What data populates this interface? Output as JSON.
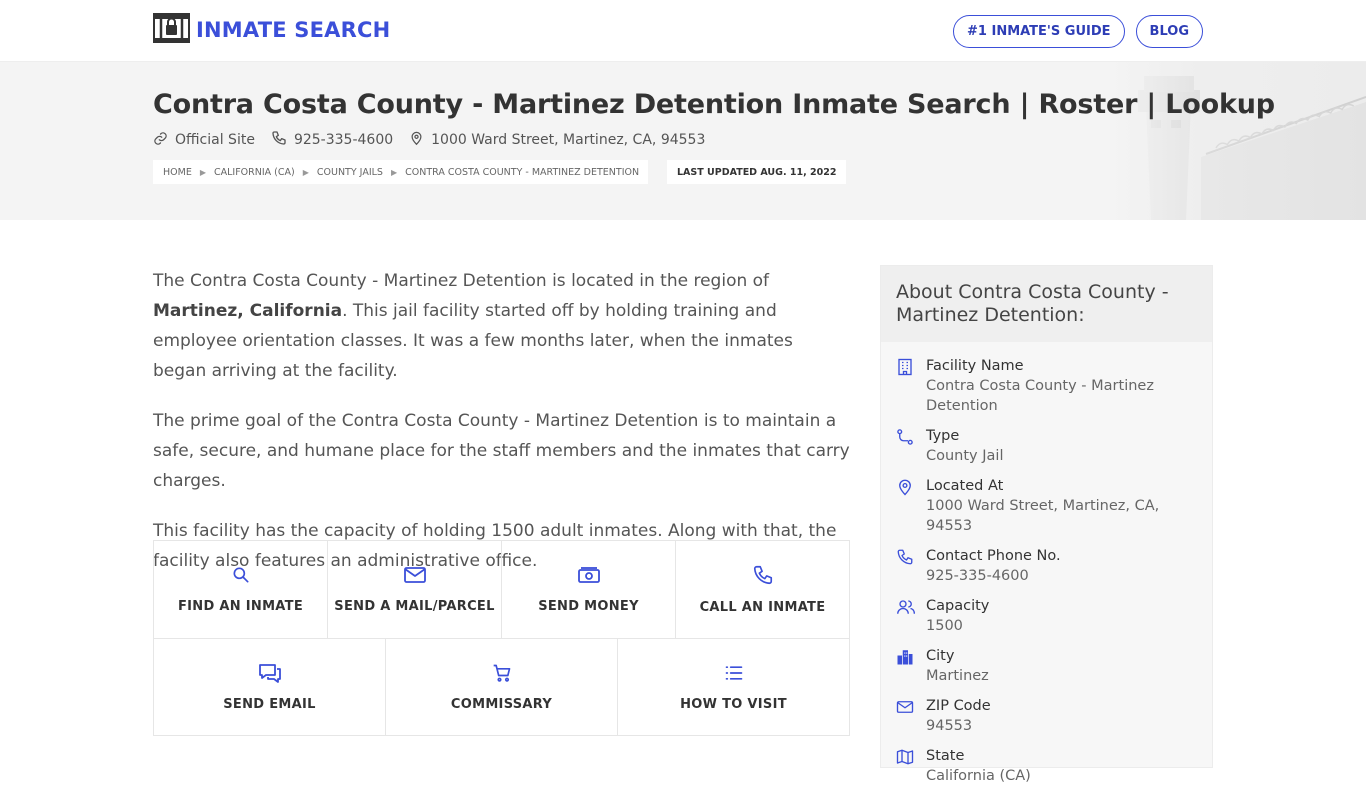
{
  "header": {
    "brand": "INMATE SEARCH",
    "nav": [
      "#1 INMATE'S GUIDE",
      "BLOG"
    ]
  },
  "hero": {
    "title": "Contra Costa County - Martinez Detention Inmate Search | Roster | Lookup",
    "official_site": "Official Site",
    "phone": "925-335-4600",
    "address": "1000 Ward Street, Martinez, CA, 94553",
    "breadcrumb": [
      "HOME",
      "CALIFORNIA (CA)",
      "COUNTY JAILS",
      "CONTRA COSTA COUNTY - MARTINEZ DETENTION"
    ],
    "last_updated": "LAST UPDATED AUG. 11, 2022"
  },
  "main": {
    "p1_before": "The Contra Costa County - Martinez Detention is located in the region of ",
    "p1_bold": "Martinez, California",
    "p1_after": ". This jail facility started off by holding training and employee orientation classes. It was a few months later, when the inmates began arriving at the facility.",
    "p2": "The prime goal of the Contra Costa County - Martinez Detention is to maintain a safe, secure, and humane place for the staff members and the inmates that carry charges.",
    "p3": "This facility has the capacity of holding 1500 adult inmates. Along with that, the facility also features an administrative office.",
    "actions_row1": [
      {
        "label": "FIND AN INMATE",
        "icon": "search-icon"
      },
      {
        "label": "SEND A MAIL/PARCEL",
        "icon": "mail-icon"
      },
      {
        "label": "SEND MONEY",
        "icon": "money-icon"
      },
      {
        "label": "CALL AN INMATE",
        "icon": "phone-icon"
      }
    ],
    "actions_row2": [
      {
        "label": "SEND EMAIL",
        "icon": "chat-icon"
      },
      {
        "label": "COMMISSARY",
        "icon": "cart-icon"
      },
      {
        "label": "HOW TO VISIT",
        "icon": "list-icon"
      }
    ]
  },
  "sidebar": {
    "title": "About Contra Costa County - Martinez Detention:",
    "items": [
      {
        "label": "Facility Name",
        "value": "Contra Costa County - Martinez Detention",
        "icon": "building-icon"
      },
      {
        "label": "Type",
        "value": "County Jail",
        "icon": "route-icon"
      },
      {
        "label": "Located At",
        "value": "1000 Ward Street, Martinez, CA, 94553",
        "icon": "location-icon"
      },
      {
        "label": "Contact Phone No.",
        "value": "925-335-4600",
        "icon": "phone-icon"
      },
      {
        "label": "Capacity",
        "value": "1500",
        "icon": "users-icon"
      },
      {
        "label": "City",
        "value": "Martinez",
        "icon": "city-icon"
      },
      {
        "label": "ZIP Code",
        "value": "94553",
        "icon": "mail-icon"
      },
      {
        "label": "State",
        "value": "California (CA)",
        "icon": "map-icon"
      }
    ]
  },
  "colors": {
    "accent": "#3b4fd9",
    "text": "#555555",
    "hero_bg": "#f4f4f4"
  }
}
